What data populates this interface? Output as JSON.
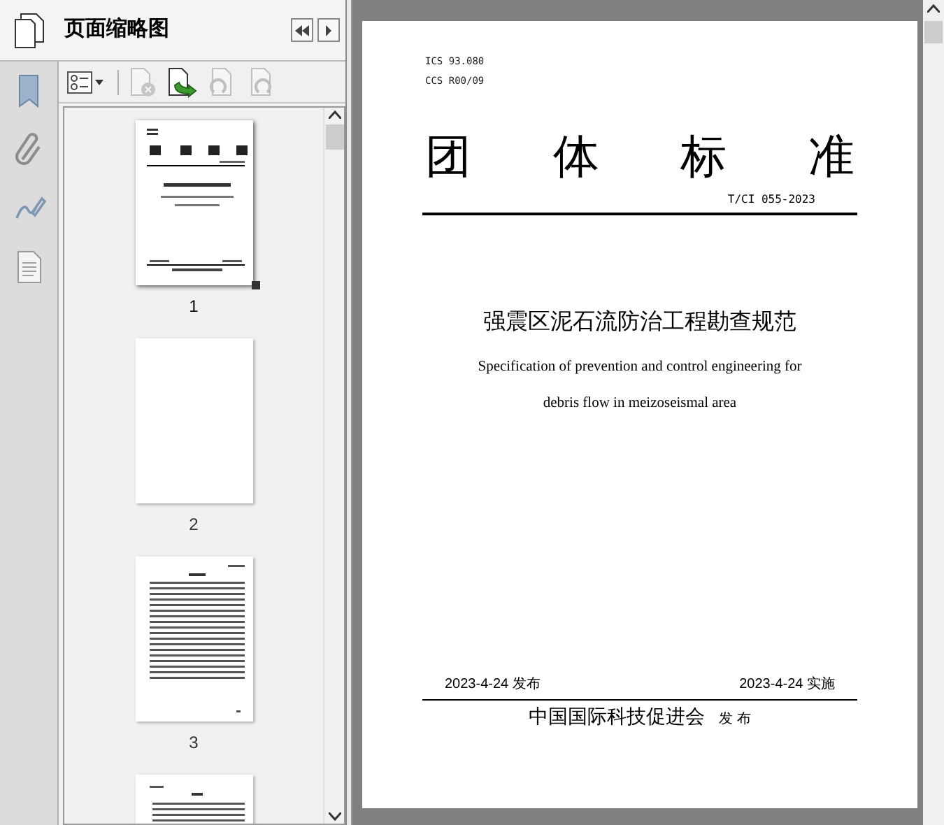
{
  "panel": {
    "title": "页面缩略图"
  },
  "header_buttons": [
    {
      "kind": "back"
    },
    {
      "kind": "forward"
    }
  ],
  "sidebar": [
    {
      "kind": "bookmark"
    },
    {
      "kind": "attachment"
    },
    {
      "kind": "signature"
    },
    {
      "kind": "document"
    }
  ],
  "toolbar": [
    {
      "kind": "options",
      "disabled": false
    },
    {
      "kind": "delete",
      "disabled": true
    },
    {
      "kind": "insert",
      "disabled": false
    },
    {
      "kind": "undo",
      "disabled": true
    },
    {
      "kind": "redo",
      "disabled": true
    }
  ],
  "thumbnails": [
    {
      "kind": "cover",
      "label": "1",
      "selected": true
    },
    {
      "kind": "blank",
      "label": "2",
      "selected": false
    },
    {
      "kind": "contents",
      "label": "3",
      "selected": false
    },
    {
      "kind": "text",
      "selected": false
    }
  ],
  "page": {
    "codes": [
      "ICS 93.080",
      "CCS R00/09"
    ],
    "heading": [
      "团",
      "体",
      "标",
      "准"
    ],
    "number": "T/CI 055-2023",
    "title": "强震区泥石流防治工程勘查规范",
    "subtitle": [
      "Specification of prevention and control engineering for",
      "debris flow in meizoseismal area"
    ],
    "issued": "2023-4-24 发布",
    "effective": "2023-4-24 实施",
    "publisher": "中国国际科技促进会",
    "publisher_suffix": "发 布"
  }
}
